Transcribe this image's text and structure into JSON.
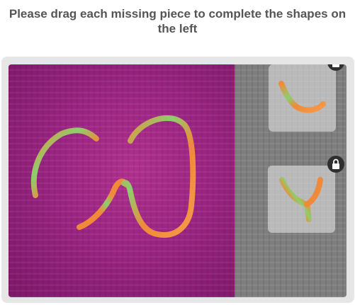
{
  "header": {
    "title": "Please drag each missing piece to complete the shapes on the left"
  },
  "pieces": [
    {
      "name": "piece-1",
      "locked_icon": "lock-icon"
    },
    {
      "name": "piece-2",
      "locked_icon": "lock-icon"
    }
  ],
  "colors": {
    "board": "#8f1f78",
    "tray": "#7e7e7e",
    "stroke_orange": "#f08a3a",
    "stroke_green": "#8ccf6e"
  }
}
